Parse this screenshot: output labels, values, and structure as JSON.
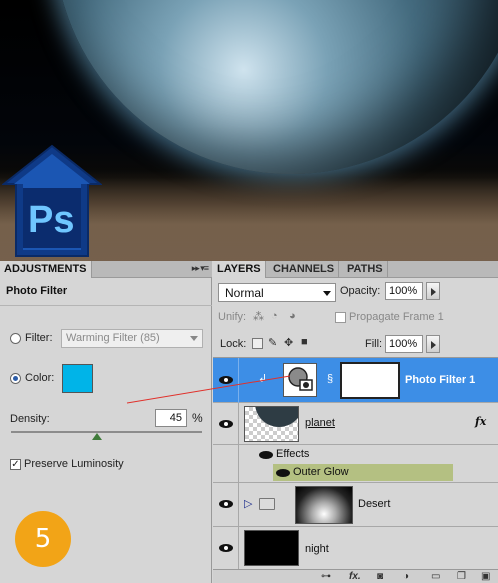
{
  "colors": {
    "selected_row": "#3d8ee6",
    "swatch": "#00b4e8",
    "outer_glow_row": "#b4c082",
    "step_badge": "#f2a417",
    "ps_logo_blue": "#1b56b3"
  },
  "logo": {
    "text": "Ps"
  },
  "step_badge": {
    "text": "5"
  },
  "adjustments": {
    "tab_label": "ADJUSTMENTS",
    "menu_glyph": "▸▸ ▾≡",
    "title": "Photo Filter",
    "filter_label": "Filter:",
    "filter_value": "Warming Filter (85)",
    "color_label": "Color:",
    "density_label": "Density:",
    "density_value": "45",
    "density_unit": "%",
    "density_fraction": 0.45,
    "preserve_label": "Preserve Luminosity",
    "preserve_checked": true,
    "selected_option": "color"
  },
  "layers_panel": {
    "tabs": [
      "LAYERS",
      "CHANNELS",
      "PATHS"
    ],
    "blend_mode": "Normal",
    "opacity_label": "Opacity:",
    "opacity_value": "100%",
    "unify_label": "Unify:",
    "propagate_label": "Propagate Frame 1",
    "lock_label": "Lock:",
    "fill_label": "Fill:",
    "fill_value": "100%",
    "layers": [
      {
        "name": "Photo Filter 1",
        "selected": true,
        "type": "adjustment"
      },
      {
        "name": "planet",
        "selected": false,
        "type": "image",
        "fx": "fx"
      },
      {
        "name": "Effects",
        "type": "effects-header"
      },
      {
        "name": "Outer Glow",
        "type": "effect"
      },
      {
        "name": "Desert",
        "selected": false,
        "type": "group"
      },
      {
        "name": "night",
        "selected": false,
        "type": "image"
      }
    ],
    "bottom_icons": [
      "link-icon",
      "fx-icon",
      "mask-icon",
      "adjustment-icon",
      "group-icon",
      "new-layer-icon",
      "trash-icon"
    ]
  }
}
